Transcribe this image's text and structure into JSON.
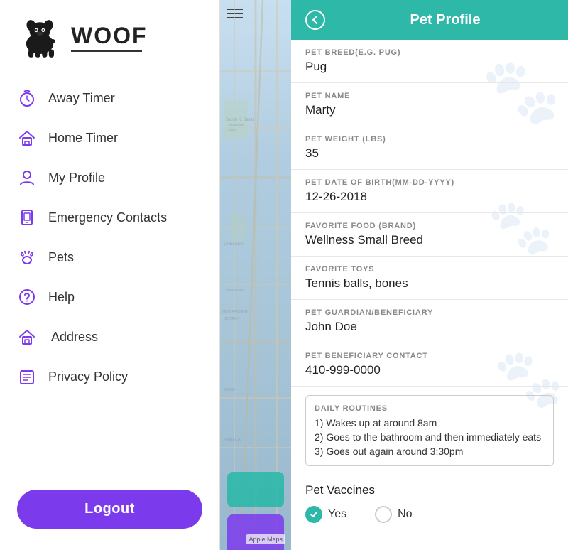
{
  "app": {
    "name": "WOOF"
  },
  "sidebar": {
    "nav_items": [
      {
        "id": "away-timer",
        "label": "Away Timer",
        "icon": "away-timer-icon"
      },
      {
        "id": "home-timer",
        "label": "Home Timer",
        "icon": "home-timer-icon"
      },
      {
        "id": "my-profile",
        "label": "My Profile",
        "icon": "profile-icon"
      },
      {
        "id": "emergency-contacts",
        "label": "Emergency Contacts",
        "icon": "emergency-icon"
      },
      {
        "id": "pets",
        "label": "Pets",
        "icon": "pets-icon"
      },
      {
        "id": "help",
        "label": "Help",
        "icon": "help-icon"
      },
      {
        "id": "address",
        "label": "Address",
        "icon": "address-icon"
      },
      {
        "id": "privacy-policy",
        "label": "Privacy Policy",
        "icon": "privacy-icon"
      }
    ],
    "logout_label": "Logout"
  },
  "map": {
    "apple_maps_label": "Apple Maps"
  },
  "pet_profile": {
    "header_title": "Pet Profile",
    "back_label": "←",
    "fields": [
      {
        "label": "PET BREED(E.G. PUG)",
        "value": "Pug"
      },
      {
        "label": "PET NAME",
        "value": "Marty"
      },
      {
        "label": "PET WEIGHT (LBS)",
        "value": "35"
      },
      {
        "label": "PET DATE OF BIRTH(MM-DD-YYYY)",
        "value": "12-26-2018"
      },
      {
        "label": "FAVORITE FOOD (BRAND)",
        "value": "Wellness Small Breed"
      },
      {
        "label": "FAVORITE TOYS",
        "value": "Tennis balls, bones"
      },
      {
        "label": "PET GUARDIAN/BENEFICIARY",
        "value": "John Doe"
      },
      {
        "label": "PET BENEFICIARY CONTACT",
        "value": "410-999-0000"
      }
    ],
    "daily_routines": {
      "label": "DAILY ROUTINES",
      "items": [
        "1) Wakes up at around 8am",
        "2) Goes to the bathroom and then immediately eats",
        "3) Goes out again around 3:30pm"
      ]
    },
    "vaccines": {
      "title": "Pet Vaccines",
      "yes_label": "Yes",
      "no_label": "No",
      "selected": "yes"
    }
  }
}
